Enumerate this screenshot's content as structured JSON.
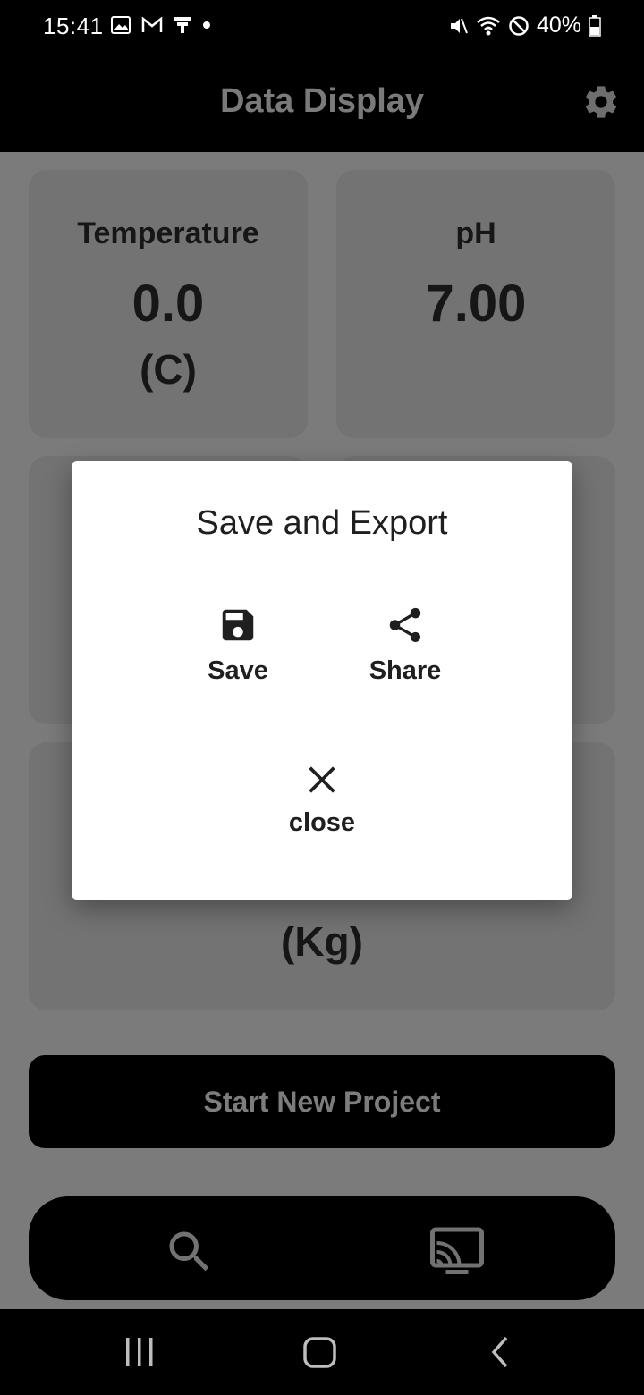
{
  "status_bar": {
    "time": "15:41",
    "battery": "40%"
  },
  "app_bar": {
    "title": "Data Display"
  },
  "cards": {
    "temperature": {
      "label": "Temperature",
      "value": "0.0",
      "unit": "(C)"
    },
    "ph": {
      "label": "pH",
      "value": "7.00"
    },
    "weight": {
      "unit": "(Kg)"
    }
  },
  "start_button": {
    "label": "Start New Project"
  },
  "dialog": {
    "title": "Save and Export",
    "save_label": "Save",
    "share_label": "Share",
    "close_label": "close"
  },
  "icons": {
    "settings": "gear-icon",
    "search": "search-icon",
    "cast": "cast-icon",
    "save": "floppy-disk-icon",
    "share": "share-icon",
    "close": "close-icon"
  },
  "colors": {
    "overlay_background": "#7b7b7b",
    "card_background": "#737373",
    "dialog_background": "#ffffff"
  }
}
